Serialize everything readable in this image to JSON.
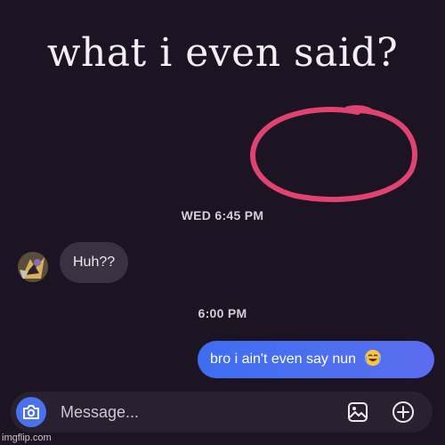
{
  "meme": {
    "caption": "what i even said?",
    "circle_color": "#e0436f",
    "watermark": "imgflip.com"
  },
  "chat": {
    "timestamp_1": "WED 6:45 PM",
    "incoming_message": "Huh??",
    "avatar_icon": "avatar-illustration",
    "timestamp_2": "6:00 PM",
    "outgoing_message": "bro i ain't even say nun",
    "outgoing_emoji": "crying-laughing-emoji",
    "outgoing_color": "#3e6df2"
  },
  "composer": {
    "placeholder": "Message...",
    "camera_icon": "camera-icon",
    "gallery_icon": "gallery-icon",
    "add_icon": "add-icon"
  }
}
